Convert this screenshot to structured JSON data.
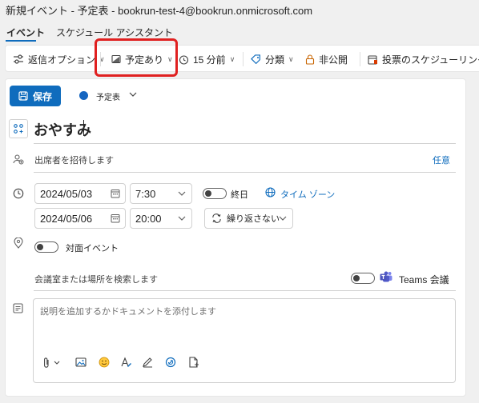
{
  "window": {
    "title": "新規イベント - 予定表 - bookrun-test-4@bookrun.onmicrosoft.com"
  },
  "tabs": [
    {
      "label": "イベント",
      "active": true
    },
    {
      "label": "スケジュール アシスタント",
      "active": false
    }
  ],
  "toolbar": {
    "response_options": "返信オプション",
    "show_as": "予定あり",
    "reminder": "15 分前",
    "categorize": "分類",
    "private": "非公開",
    "poll_scheduling": "投票のスケジューリング"
  },
  "form": {
    "save_label": "保存",
    "calendar_name": "予定表",
    "calendar_color": "#1565c0",
    "event_title": "おやすみ",
    "attendees_placeholder": "出席者を招待します",
    "optional_label": "任意",
    "start_date": "2024/05/03",
    "start_time": "7:30",
    "all_day_label": "終日",
    "time_zone_label": "タイム ゾーン",
    "end_date": "2024/05/06",
    "end_time": "20:00",
    "repeat_label": "繰り返さない",
    "in_person_label": "対面イベント",
    "location_placeholder": "会議室または場所を検索します",
    "teams_label": "Teams 会議",
    "description_placeholder": "説明を追加するかドキュメントを添付します"
  },
  "colors": {
    "accent": "#0f6cbd",
    "highlight": "#e02020"
  }
}
